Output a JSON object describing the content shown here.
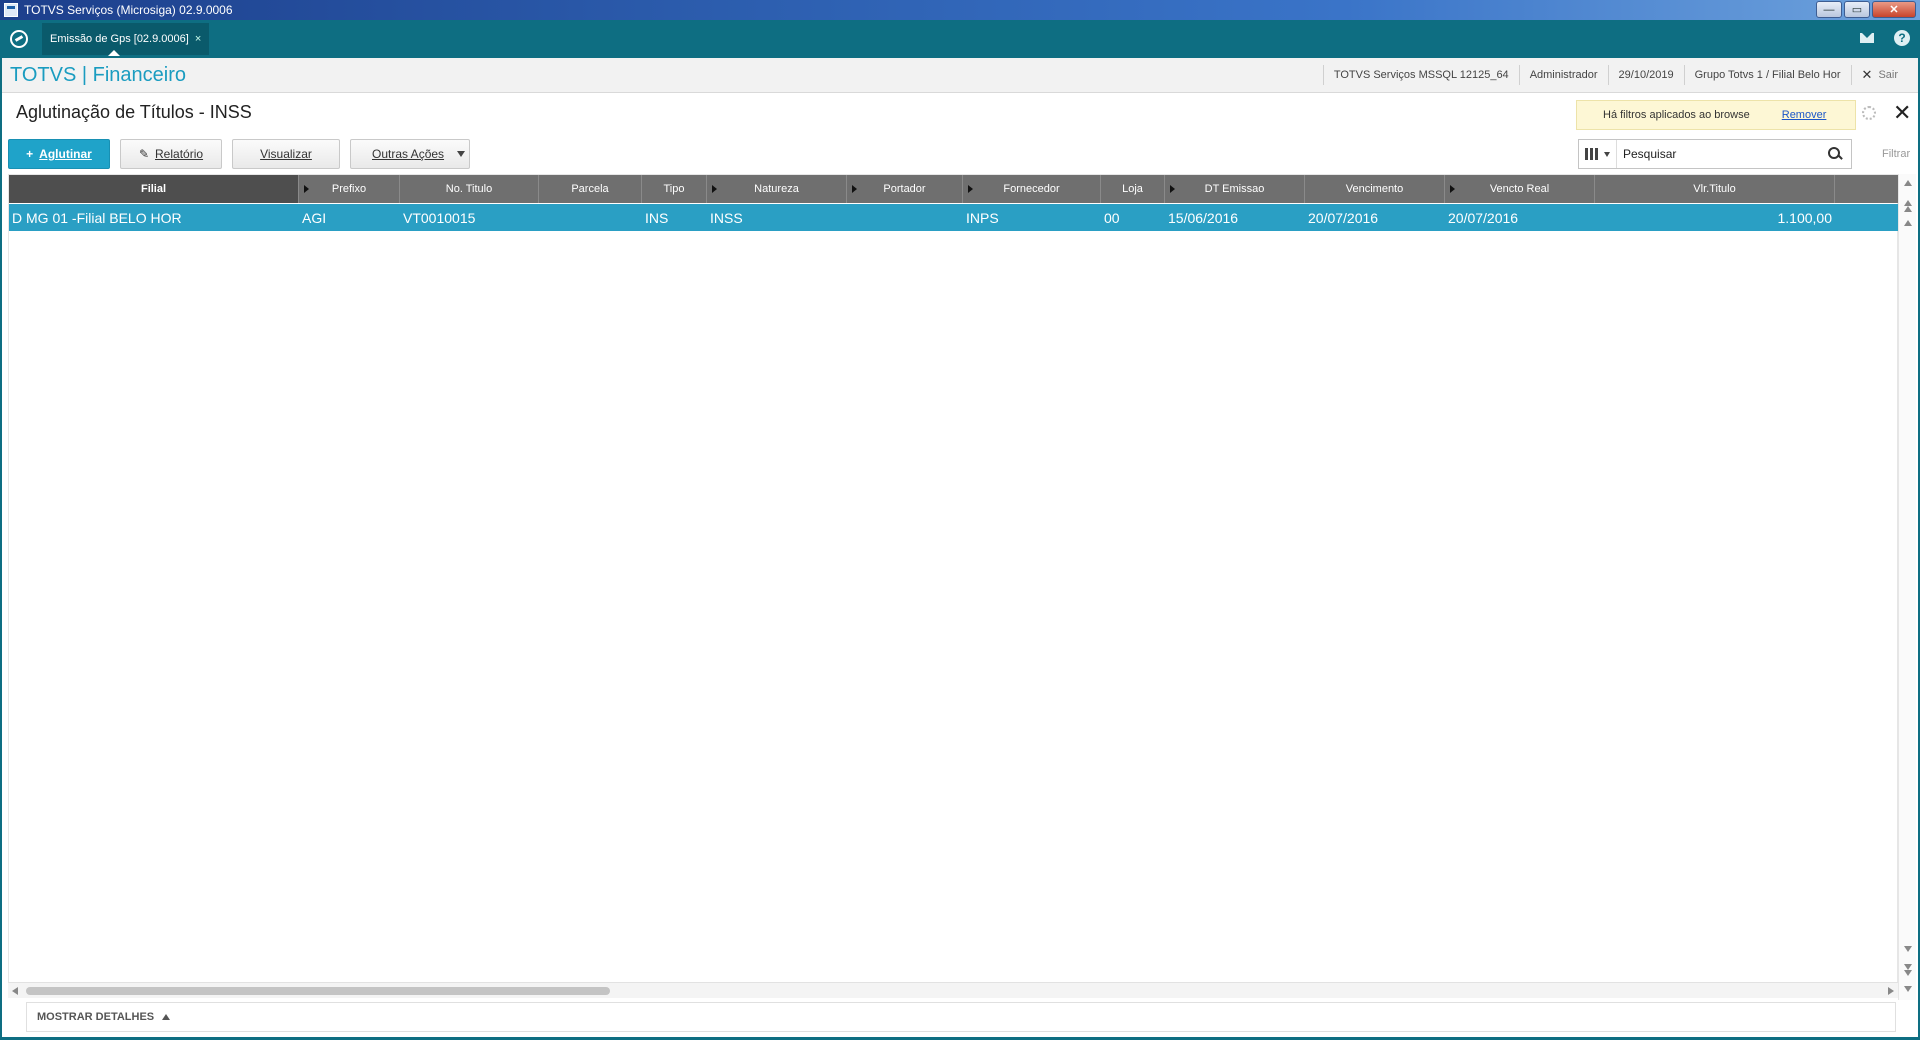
{
  "window": {
    "title": "TOTVS Serviços (Microsiga) 02.9.0006",
    "minimize_glyph": "—",
    "maximize_glyph": "▭",
    "close_glyph": "✕"
  },
  "tabbar": {
    "active_tab": "Emissão de Gps [02.9.0006]",
    "tab_close": "×",
    "help_glyph": "?"
  },
  "module": {
    "title": "TOTVS | Financeiro",
    "environment": "TOTVS Serviços MSSQL 12125_64",
    "user": "Administrador",
    "date": "29/10/2019",
    "branch": "Grupo Totvs 1 / Filial Belo Hor",
    "logout_icon": "✕",
    "logout": "Sair"
  },
  "page": {
    "title": "Aglutinação de Títulos - INSS",
    "filter_notice": "Há filtros aplicados ao browse",
    "filter_remove": "Remover",
    "close_glyph": "✕"
  },
  "toolbar": {
    "primary_icon": "+",
    "primary_label": "Aglutinar",
    "report_icon": "✎",
    "report_label": "Relatório",
    "view_label": "Visualizar",
    "other_label": "Outras Ações",
    "search_placeholder": "Pesquisar",
    "filter_label": "Filtrar"
  },
  "grid": {
    "columns": [
      "Filial",
      "Prefixo",
      "No. Titulo",
      "Parcela",
      "Tipo",
      "Natureza",
      "Portador",
      "Fornecedor",
      "Loja",
      "DT Emissao",
      "Vencimento",
      "Vencto Real",
      "Vlr.Titulo"
    ],
    "rows": [
      [
        "D MG 01 -Filial BELO HOR",
        "AGI",
        "VT0010015",
        "",
        "INS",
        "INSS",
        "",
        "INPS",
        "00",
        "15/06/2016",
        "20/07/2016",
        "20/07/2016",
        "1.100,00"
      ]
    ]
  },
  "footer": {
    "details_label": "MOSTRAR DETALHES"
  },
  "colors": {
    "accent": "#1fa3c9",
    "tabbar": "#0e6e82",
    "selected_row": "#2a9fc4",
    "grid_header": "#6f6f6f"
  }
}
